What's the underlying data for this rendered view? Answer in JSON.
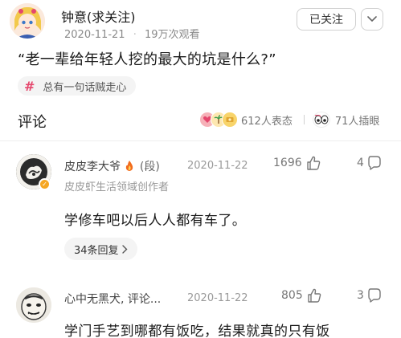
{
  "post": {
    "author_name": "钟意(求关注)",
    "date": "2020-11-21",
    "views": "19万次观看",
    "follow_label": "已关注",
    "question": "“老一辈给年轻人挖的最大的坑是什么?”",
    "topic": "总有一句话贼走心"
  },
  "comments_section": {
    "title": "评论",
    "reactions": [
      {
        "count_label": "612人表态"
      },
      {
        "count_label": "71人插眼"
      }
    ]
  },
  "comments": [
    {
      "name": "皮皮李大爷",
      "badge": "(段)",
      "subtitle": "皮皮虾生活领域创作者",
      "date": "2020-11-22",
      "likes": "1696",
      "replies_count": "4",
      "text": "学修车吧以后人人都有车了。",
      "replies_label": "34条回复"
    },
    {
      "name": "心中无黑犬, 评论...",
      "date": "2020-11-22",
      "likes": "805",
      "replies_count": "3",
      "text": "学门手艺到哪都有饭吃，结果就真的只有饭"
    }
  ],
  "colors": {
    "accent_pink": "#e5476d",
    "verified_orange": "#f5a623",
    "flame": "#f26b1d"
  }
}
